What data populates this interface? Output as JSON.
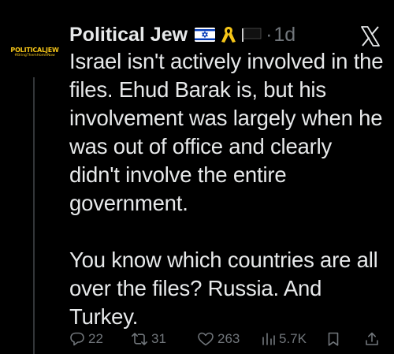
{
  "author": {
    "display_name": "Political Jew",
    "avatar_text": "POLITICALJEW",
    "avatar_subtext": "#BringThemHomeNow",
    "badges": [
      "israel-flag-icon",
      "yellow-ribbon-icon",
      "black-flag-icon"
    ]
  },
  "meta": {
    "separator": "·",
    "timestamp": "1d",
    "platform_icon": "x-logo-icon"
  },
  "tweet": {
    "text": "Israel isn't actively involved in the files. Ehud Barak is, but his involvement was largely when he was out of office and clearly didn't involve the entire government.\n\nYou know which countries are all over the files? Russia. And Turkey."
  },
  "actions": {
    "replies": "22",
    "reposts": "31",
    "likes": "263",
    "views": "5.7K"
  },
  "colors": {
    "background": "#000000",
    "text": "#e7e9ea",
    "muted": "#71767b",
    "thread_line": "#333639",
    "avatar_brand": "#f5c518"
  }
}
